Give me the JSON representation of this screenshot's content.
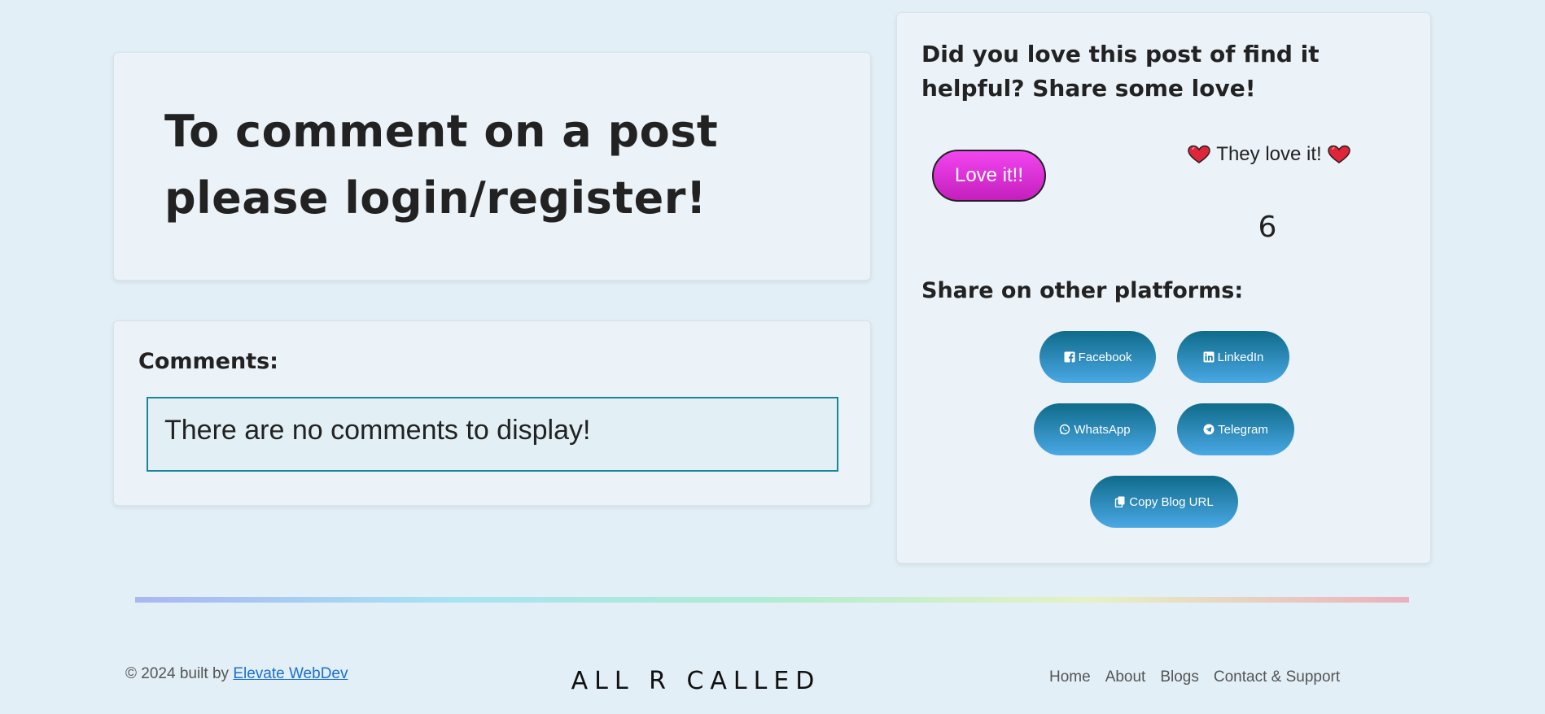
{
  "login_prompt": {
    "text": "To comment on a post please login/register!"
  },
  "comments": {
    "heading": "Comments:",
    "empty_message": "There are no comments to display!"
  },
  "share": {
    "love_heading": "Did you love this post of find it helpful? Share some love!",
    "love_button_label": "Love it!!",
    "love_status_text": "They love it!",
    "love_count": "6",
    "platforms_heading": "Share on other platforms:",
    "facebook_label": "Facebook",
    "linkedin_label": "LinkedIn",
    "whatsapp_label": "WhatsApp",
    "telegram_label": "Telegram",
    "copy_url_label": "Copy Blog URL",
    "love_button_color": "#e23fe0",
    "share_button_color": "#1f7fb3",
    "heart_icon": "heart-icon"
  },
  "footer": {
    "copyright_prefix": "© 2024 built by",
    "copyright_link": "Elevate WebDev",
    "brand": "ALL R CALLED",
    "nav": {
      "home": "Home",
      "about": "About",
      "blogs": "Blogs",
      "contact": "Contact & Support"
    }
  }
}
